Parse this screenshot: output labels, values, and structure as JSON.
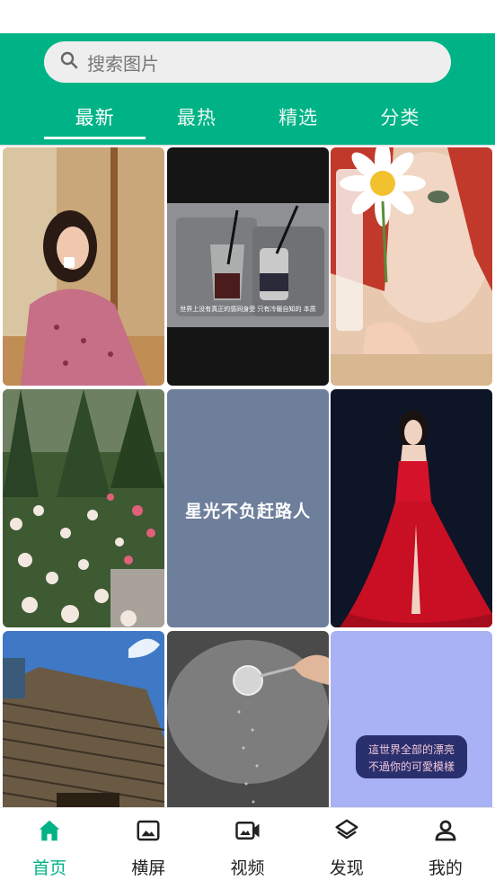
{
  "search": {
    "placeholder": "搜索图片",
    "icon": "search-icon"
  },
  "tabs": [
    {
      "label": "最新",
      "active": true
    },
    {
      "label": "最热",
      "active": false
    },
    {
      "label": "精选",
      "active": false
    },
    {
      "label": "分类",
      "active": false
    }
  ],
  "photos": [
    {
      "subject": "woman-in-pink-dress-drinking"
    },
    {
      "subject": "drinks-on-tray",
      "caption": "世界上没有真正的感同身受 只有冷暖自知的 本质"
    },
    {
      "subject": "woman-holding-daisy"
    },
    {
      "subject": "rose-bushes"
    },
    {
      "subject": "quote-card",
      "quote": "星光不负赶路人"
    },
    {
      "subject": "woman-in-red-gown"
    },
    {
      "subject": "building-facade"
    },
    {
      "subject": "dessert-powdered-sugar"
    },
    {
      "subject": "handwritten-quote",
      "quote_line1": "這世界全部的漂亮",
      "quote_line2": "不過你的可愛模樣"
    }
  ],
  "nav": [
    {
      "label": "首页",
      "icon": "home-icon",
      "active": true
    },
    {
      "label": "横屏",
      "icon": "image-icon",
      "active": false
    },
    {
      "label": "视频",
      "icon": "video-icon",
      "active": false
    },
    {
      "label": "发现",
      "icon": "layers-icon",
      "active": false
    },
    {
      "label": "我的",
      "icon": "person-icon",
      "active": false
    }
  ],
  "colors": {
    "accent": "#00b386",
    "inactive": "#222222"
  }
}
